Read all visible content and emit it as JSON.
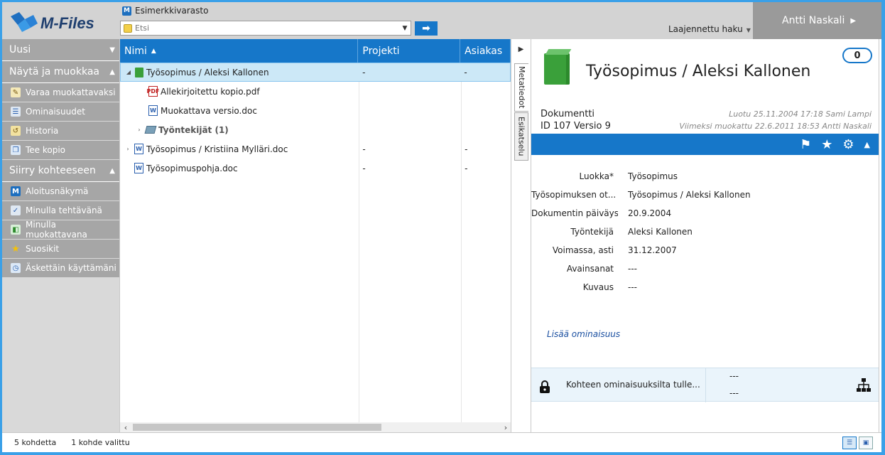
{
  "app": {
    "logo_text": "M-Files"
  },
  "header": {
    "vault_name": "Esimerkkivarasto",
    "search": {
      "placeholder": "Etsi"
    },
    "advanced_search": "Laajennettu haku",
    "user_name": "Antti Naskali"
  },
  "sidebar": {
    "new_label": "Uusi",
    "view_edit": {
      "title": "Näytä ja muokkaa",
      "items": [
        {
          "label": "Varaa muokattavaksi",
          "icon": "edit-icon"
        },
        {
          "label": "Ominaisuudet",
          "icon": "properties-icon"
        },
        {
          "label": "Historia",
          "icon": "history-icon"
        },
        {
          "label": "Tee kopio",
          "icon": "copy-icon"
        }
      ]
    },
    "goto": {
      "title": "Siirry kohteeseen",
      "items": [
        {
          "label": "Aloitusnäkymä",
          "icon": "home-icon"
        },
        {
          "label": "Minulla tehtävänä",
          "icon": "tasks-icon"
        },
        {
          "label": "Minulla muokattavana",
          "icon": "checked-out-icon"
        },
        {
          "label": "Suosikit",
          "icon": "star-icon"
        },
        {
          "label": "Äskettäin käyttämäni",
          "icon": "recent-icon"
        }
      ]
    }
  },
  "list": {
    "columns": [
      "Nimi",
      "Projekti",
      "Asiakas"
    ],
    "rows": [
      {
        "name": "Työsopimus / Aleksi Kallonen",
        "project": "-",
        "customer": "-"
      },
      {
        "name": "Allekirjoitettu kopio.pdf",
        "project": "",
        "customer": ""
      },
      {
        "name": "Muokattava versio.doc",
        "project": "",
        "customer": ""
      },
      {
        "name": "Työntekijät (1)",
        "project": "",
        "customer": ""
      },
      {
        "name": "Työsopimus / Kristiina Mylläri.doc",
        "project": "-",
        "customer": "-"
      },
      {
        "name": "Työsopimuspohja.doc",
        "project": "-",
        "customer": "-"
      }
    ]
  },
  "tabs": {
    "metadata": "Metatiedot",
    "preview": "Esikatselu"
  },
  "details": {
    "title": "Työsopimus / Aleksi Kallonen",
    "comments_count": "0",
    "type": "Dokumentti",
    "id_version": "ID 107  Versio 9",
    "created": "Luotu 25.11.2004 17:18 Sami Lampi",
    "modified": "Viimeksi muokattu 22.6.2011 18:53 Antti Naskali",
    "properties": [
      {
        "key": "Luokka*",
        "value": "Työsopimus"
      },
      {
        "key": "Työsopimuksen ot... *",
        "value": "Työsopimus / Aleksi Kallonen"
      },
      {
        "key": "Dokumentin päiväys*",
        "value": "20.9.2004"
      },
      {
        "key": "Työntekijä",
        "value": "Aleksi Kallonen"
      },
      {
        "key": "Voimassa, asti",
        "value": "31.12.2007"
      },
      {
        "key": "Avainsanat",
        "value": "---"
      },
      {
        "key": "Kuvaus",
        "value": "---"
      }
    ],
    "add_property": "Lisää ominaisuus",
    "permissions": {
      "text": "Kohteen ominaisuuksilta tulle...",
      "line1": "---",
      "line2": "---"
    }
  },
  "status": {
    "count": "5 kohdetta",
    "selected": "1 kohde valittu"
  },
  "colors": {
    "accent": "#1677c9",
    "sidebar": "#a6a6a6",
    "selection": "#cce8f7"
  }
}
